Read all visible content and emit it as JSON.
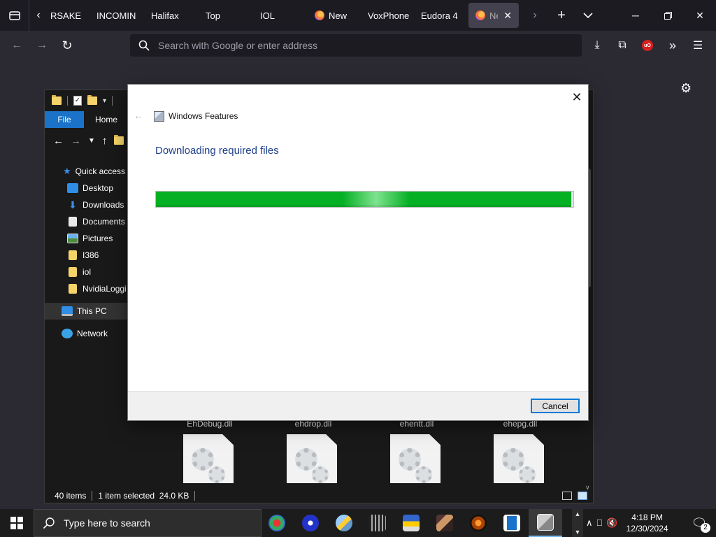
{
  "browser": {
    "tabs": [
      {
        "label": "RSAKE",
        "favicon": "none",
        "active": false
      },
      {
        "label": "INCOMIN",
        "favicon": "none",
        "active": false
      },
      {
        "label": "Halifax",
        "favicon": "none",
        "active": false
      },
      {
        "label": "Top",
        "favicon": "none",
        "active": false
      },
      {
        "label": "IOL",
        "favicon": "none",
        "active": false
      },
      {
        "label": "New",
        "favicon": "firefox-icon",
        "active": false
      },
      {
        "label": "VoxPhone",
        "favicon": "none",
        "active": false
      },
      {
        "label": "Eudora 4",
        "favicon": "none",
        "active": false
      },
      {
        "label": "Ne",
        "favicon": "firefox-icon",
        "active": true
      }
    ],
    "address_placeholder": "Search with Google or enter address",
    "accent": "#42414d"
  },
  "explorer": {
    "ribbon_tabs": [
      "File",
      "Home"
    ],
    "tree": {
      "quick_access": "Quick access",
      "items": [
        "Desktop",
        "Downloads",
        "Documents",
        "Pictures",
        "I386",
        "iol",
        "NvidiaLoggi"
      ],
      "this_pc": "This PC",
      "network": "Network"
    },
    "files": [
      "EhDebug.dll",
      "ehdrop.dll",
      "ehentt.dll",
      "ehepg.dll"
    ],
    "status": {
      "count": "40 items",
      "selection": "1 item selected  24.0 KB"
    }
  },
  "dialog": {
    "title": "Windows Features",
    "heading": "Downloading required files",
    "progress": 0.995,
    "progress_color": "#06b025",
    "cancel_label": "Cancel"
  },
  "taskbar": {
    "search_placeholder": "Type here to search",
    "time": "4:18 PM",
    "date": "12/30/2024",
    "notification_count": "2",
    "pinned_apps": [
      "app-icon-1",
      "app-icon-2",
      "app-icon-3",
      "app-icon-4",
      "app-icon-5",
      "app-icon-6",
      "app-icon-7",
      "app-icon-8",
      "app-icon-9"
    ]
  }
}
